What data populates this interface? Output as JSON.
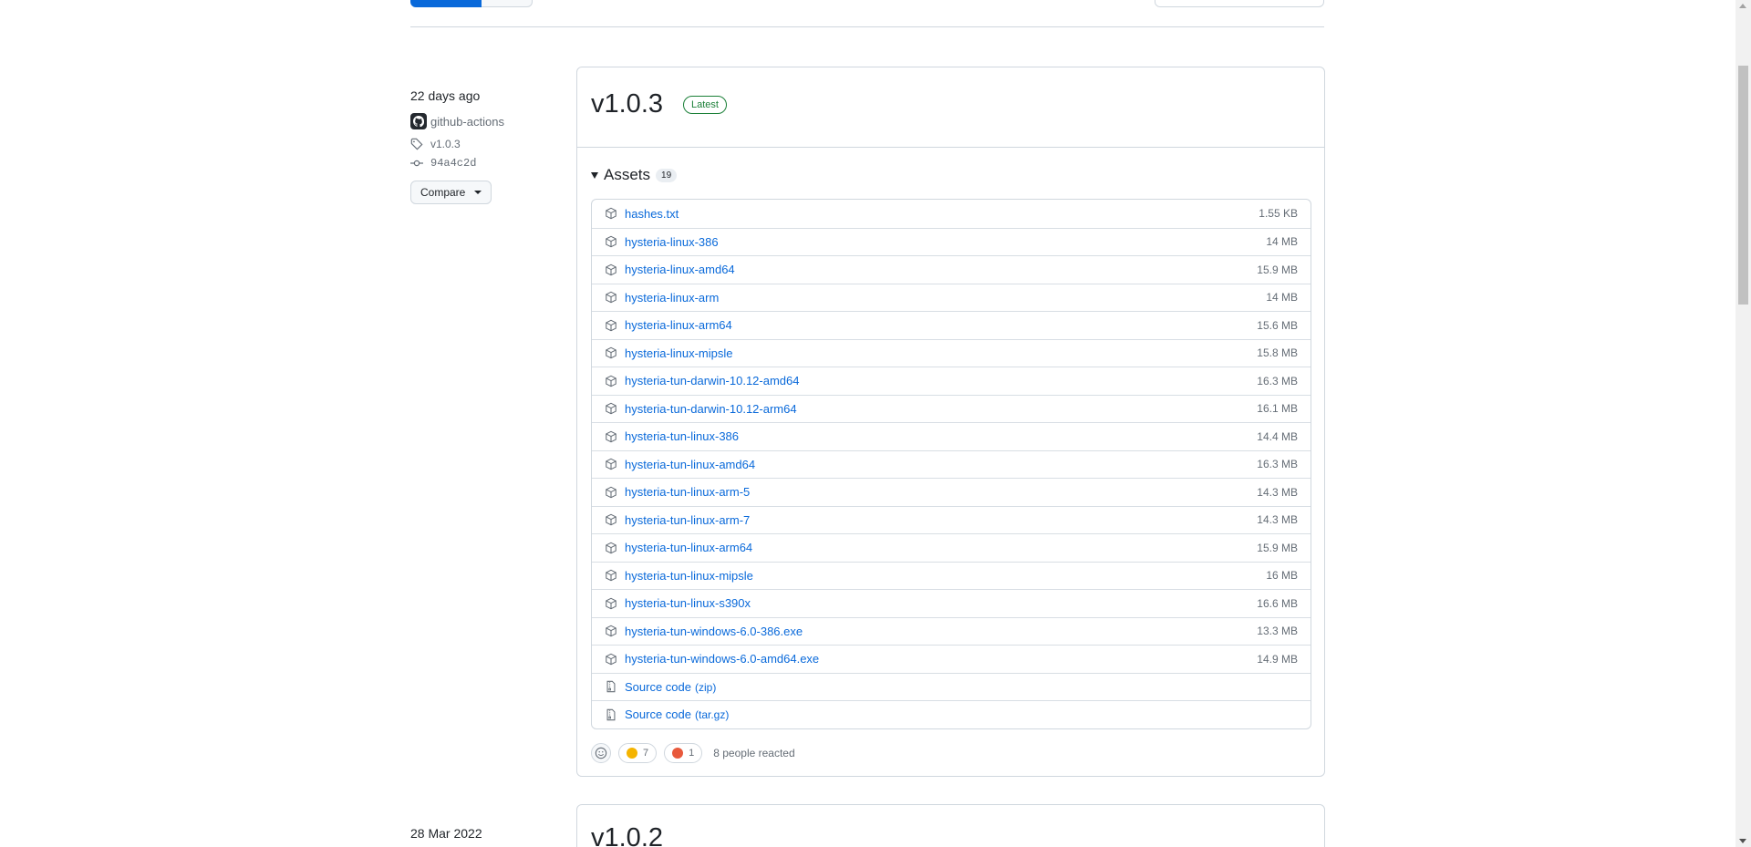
{
  "release": {
    "date": "22 days ago",
    "author": "github-actions",
    "tag": "v1.0.3",
    "commit": "94a4c2d",
    "compare_label": "Compare",
    "title": "v1.0.3",
    "latest_label": "Latest",
    "assets_label": "Assets",
    "assets_count": "19",
    "assets": [
      {
        "name": "hashes.txt",
        "size": "1.55 KB",
        "icon": "package-icon"
      },
      {
        "name": "hysteria-linux-386",
        "size": "14 MB",
        "icon": "package-icon"
      },
      {
        "name": "hysteria-linux-amd64",
        "size": "15.9 MB",
        "icon": "package-icon"
      },
      {
        "name": "hysteria-linux-arm",
        "size": "14 MB",
        "icon": "package-icon"
      },
      {
        "name": "hysteria-linux-arm64",
        "size": "15.6 MB",
        "icon": "package-icon"
      },
      {
        "name": "hysteria-linux-mipsle",
        "size": "15.8 MB",
        "icon": "package-icon"
      },
      {
        "name": "hysteria-tun-darwin-10.12-amd64",
        "size": "16.3 MB",
        "icon": "package-icon"
      },
      {
        "name": "hysteria-tun-darwin-10.12-arm64",
        "size": "16.1 MB",
        "icon": "package-icon"
      },
      {
        "name": "hysteria-tun-linux-386",
        "size": "14.4 MB",
        "icon": "package-icon"
      },
      {
        "name": "hysteria-tun-linux-amd64",
        "size": "16.3 MB",
        "icon": "package-icon"
      },
      {
        "name": "hysteria-tun-linux-arm-5",
        "size": "14.3 MB",
        "icon": "package-icon"
      },
      {
        "name": "hysteria-tun-linux-arm-7",
        "size": "14.3 MB",
        "icon": "package-icon"
      },
      {
        "name": "hysteria-tun-linux-arm64",
        "size": "15.9 MB",
        "icon": "package-icon"
      },
      {
        "name": "hysteria-tun-linux-mipsle",
        "size": "16 MB",
        "icon": "package-icon"
      },
      {
        "name": "hysteria-tun-linux-s390x",
        "size": "16.6 MB",
        "icon": "package-icon"
      },
      {
        "name": "hysteria-tun-windows-6.0-386.exe",
        "size": "13.3 MB",
        "icon": "package-icon"
      },
      {
        "name": "hysteria-tun-windows-6.0-amd64.exe",
        "size": "14.9 MB",
        "icon": "package-icon"
      }
    ],
    "source_assets": [
      {
        "name": "Source code",
        "format": "(zip)",
        "icon": "file-zip-icon"
      },
      {
        "name": "Source code",
        "format": "(tar.gz)",
        "icon": "file-zip-icon"
      }
    ],
    "reactions": [
      {
        "emoji": "thumbs-up-icon",
        "count": "7",
        "color": "#f5b400"
      },
      {
        "emoji": "hooray-icon",
        "count": "1",
        "color": "#e8593c"
      }
    ],
    "reactions_summary": "8 people reacted"
  },
  "next_release": {
    "date": "28 Mar 2022",
    "title": "v1.0.2"
  },
  "colors": {
    "link": "#0969da",
    "latest_badge": "#1a7f37",
    "primary_button": "#0969da"
  }
}
